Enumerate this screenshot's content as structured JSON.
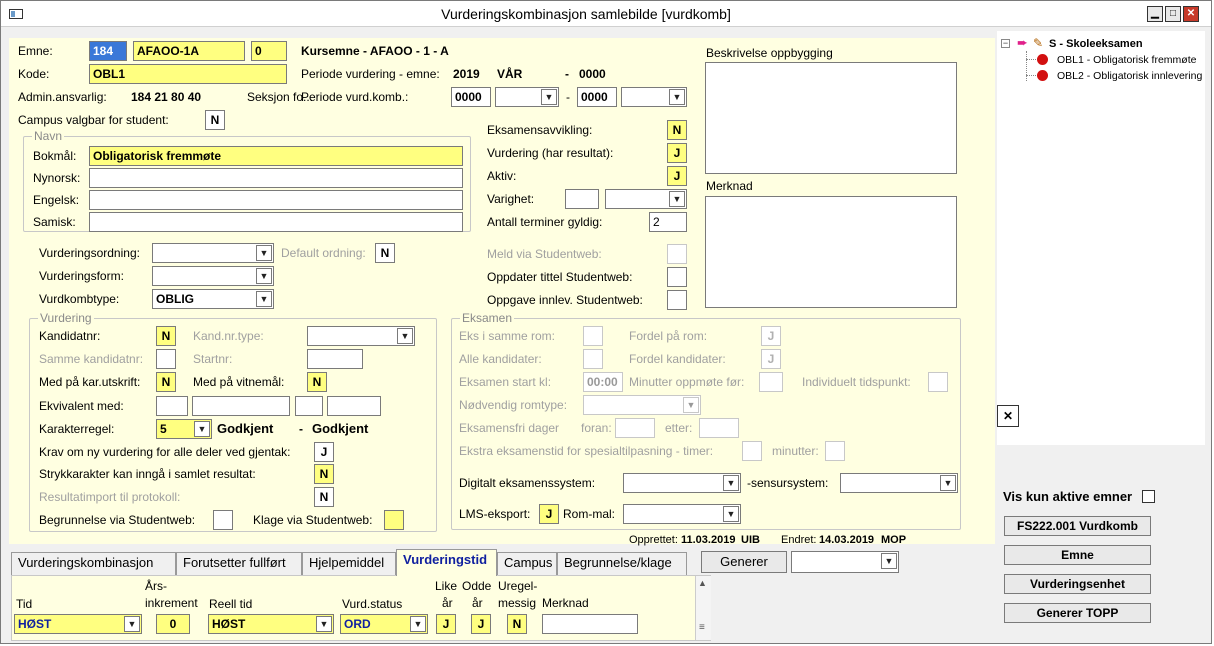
{
  "window": {
    "title": "Vurderingskombinasjon samlebilde  [vurdkomb]"
  },
  "emne": {
    "label": "Emne:",
    "inst": "184",
    "code": "AFAOO-1A",
    "version": "0",
    "desc": "Kursemne - AFAOO - 1 - A"
  },
  "kode": {
    "label": "Kode:",
    "value": "OBL1"
  },
  "periode": {
    "label": "Periode vurdering - emne:",
    "year": "2019",
    "term": "VÅR",
    "dash": "-",
    "end": "0000"
  },
  "admin": {
    "label": "Admin.ansvarlig:",
    "value": "184  21  80  40",
    "seksjon": "Seksjon fo..."
  },
  "periode_komb": {
    "label": "Periode vurd.komb.:",
    "from": "0000",
    "dash": "-",
    "to": "0000"
  },
  "campus_valgbar": {
    "label": "Campus valgbar for student:",
    "value": "N"
  },
  "navn": {
    "caption": "Navn",
    "bokmal_label": "Bokmål:",
    "bokmal": "Obligatorisk fremmøte",
    "nynorsk_label": "Nynorsk:",
    "engelsk_label": "Engelsk:",
    "samisk_label": "Samisk:"
  },
  "right": {
    "eksamensavvikling": {
      "label": "Eksamensavvikling:",
      "value": "N"
    },
    "vurdering": {
      "label": "Vurdering (har resultat):",
      "value": "J"
    },
    "aktiv": {
      "label": "Aktiv:",
      "value": "J"
    },
    "varighet": {
      "label": "Varighet:"
    },
    "terminer": {
      "label": "Antall terminer gyldig:",
      "value": "2"
    },
    "meld": {
      "label": "Meld via Studentweb:"
    },
    "oppdater": {
      "label": "Oppdater tittel Studentweb:"
    },
    "oppgave": {
      "label": "Oppgave innlev. Studentweb:"
    }
  },
  "beskrivelse": {
    "label": "Beskrivelse oppbygging"
  },
  "merknad": {
    "label": "Merknad"
  },
  "vurd_ordning": {
    "label": "Vurderingsordning:",
    "default_label": "Default ordning:",
    "default_value": "N"
  },
  "vurd_form": {
    "label": "Vurderingsform:"
  },
  "vurdkombtype": {
    "label": "Vurdkombtype:",
    "value": "OBLIG"
  },
  "vurdering_grp": {
    "caption": "Vurdering",
    "kandidatnr_label": "Kandidatnr:",
    "kandidatnr": "N",
    "kandnrtype_label": "Kand.nr.type:",
    "samme_label": "Samme kandidatnr:",
    "startnr_label": "Startnr:",
    "karutskrift_label": "Med på kar.utskrift:",
    "karutskrift": "N",
    "vitnemal_label": "Med på vitnemål:",
    "vitnemal": "N",
    "ekvivalent_label": "Ekvivalent med:",
    "karakterregel_label": "Karakterregel:",
    "karakterregel": "5",
    "godkjent1": "Godkjent",
    "godkjent_dash": "-",
    "godkjent2": "Godkjent",
    "krav_label": "Krav om ny vurdering for alle deler ved gjentak:",
    "krav": "J",
    "stryk_label": "Strykkarakter kan inngå i samlet resultat:",
    "stryk": "N",
    "resimport_label": "Resultatimport til protokoll:",
    "resimport": "N",
    "begrunnelse_label": "Begrunnelse via Studentweb:",
    "klage_label": "Klage via Studentweb:"
  },
  "eksamen_grp": {
    "caption": "Eksamen",
    "samme_rom_label": "Eks i samme rom:",
    "fordel_rom_label": "Fordel på rom:",
    "fordel_rom": "J",
    "alle_label": "Alle kandidater:",
    "fordel_kand_label": "Fordel kandidater:",
    "fordel_kand": "J",
    "start_label": "Eksamen start kl:",
    "start": "00:00",
    "oppmote_label": "Minutter oppmøte før:",
    "indiv_label": "Individuelt tidspunkt:",
    "romtype_label": "Nødvendig romtype:",
    "fri_label": "Eksamensfri dager",
    "foran_label": "foran:",
    "etter_label": "etter:",
    "ekstra_label": "Ekstra eksamenstid for spesialtilpasning - timer:",
    "minutter_label": "minutter:"
  },
  "digitalt": {
    "label": "Digitalt eksamenssystem:",
    "sensur_label": "-sensursystem:"
  },
  "lms": {
    "label": "LMS-eksport:",
    "value": "J",
    "rommal_label": "Rom-mal:"
  },
  "audit": {
    "opprettet_label": "Opprettet:",
    "opprettet": "11.03.2019",
    "opprettet_by": "UIB",
    "endret_label": "Endret:",
    "endret": "14.03.2019",
    "endret_by": "MOP"
  },
  "tabs": [
    "Vurderingskombinasjon",
    "Forutsetter fullført",
    "Hjelpemiddel",
    "Vurderingstid",
    "Campus",
    "Begrunnelse/klage"
  ],
  "generer": {
    "label": "Generer"
  },
  "grid": {
    "headers": {
      "tid": "Tid",
      "ars1": "Års-",
      "ars2": "inkrement",
      "reell": "Reell tid",
      "status": "Vurd.status",
      "like1": "Like",
      "like2": "år",
      "odde1": "Odde",
      "odde2": "år",
      "ureg1": "Uregel-",
      "ureg2": "messig",
      "merknad": "Merknad"
    },
    "row": {
      "tid": "HØST",
      "ars": "0",
      "reell": "HØST",
      "status": "ORD",
      "like": "J",
      "odde": "J",
      "ureg": "N"
    }
  },
  "tree": {
    "root": "S - Skoleeksamen",
    "items": [
      "OBL1 - Obligatorisk fremmøte",
      "OBL2 - Obligatorisk innlevering"
    ]
  },
  "side": {
    "vis_label": "Vis kun aktive emner",
    "buttons": [
      "FS222.001 Vurdkomb",
      "Emne",
      "Vurderingsenhet",
      "Generer TOPP"
    ]
  }
}
